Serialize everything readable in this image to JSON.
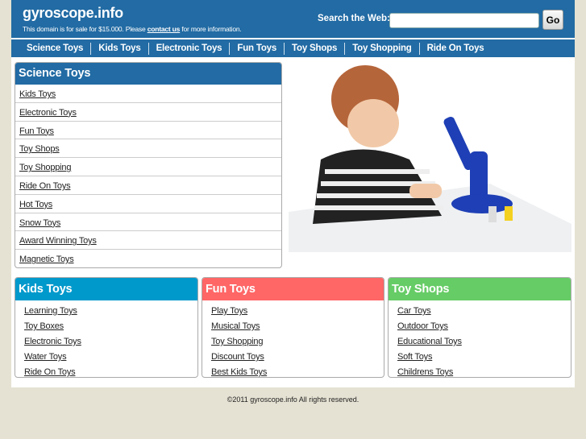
{
  "header": {
    "title": "gyroscope.info",
    "sale_prefix": "This domain is for sale for $15.000. Please ",
    "sale_link": "contact us",
    "sale_suffix": " for more information.",
    "search_label": "Search the Web:",
    "search_value": "",
    "go_label": "Go"
  },
  "nav": [
    "Science Toys",
    "Kids Toys",
    "Electronic Toys",
    "Fun Toys",
    "Toy Shops",
    "Toy Shopping",
    "Ride On Toys"
  ],
  "science": {
    "title": "Science Toys",
    "items": [
      "Kids Toys",
      "Electronic Toys",
      "Fun Toys",
      "Toy Shops",
      "Toy Shopping",
      "Ride On Toys",
      "Hot Toys",
      "Snow Toys",
      "Award Winning Toys",
      "Magnetic Toys"
    ]
  },
  "kids": {
    "title": "Kids Toys",
    "color": "#0099cc",
    "items": [
      "Learning Toys",
      "Toy Boxes",
      "Electronic Toys",
      "Water Toys",
      "Ride On Toys"
    ]
  },
  "fun": {
    "title": "Fun Toys",
    "color": "#ff6666",
    "items": [
      "Play Toys",
      "Musical Toys",
      "Toy Shopping",
      "Discount Toys",
      "Best Kids Toys"
    ]
  },
  "shops": {
    "title": "Toy Shops",
    "color": "#66cc66",
    "items": [
      "Car Toys",
      "Outdoor Toys",
      "Educational Toys",
      "Soft Toys",
      "Childrens Toys"
    ]
  },
  "footer": "©2011 gyroscope.info All rights reserved."
}
